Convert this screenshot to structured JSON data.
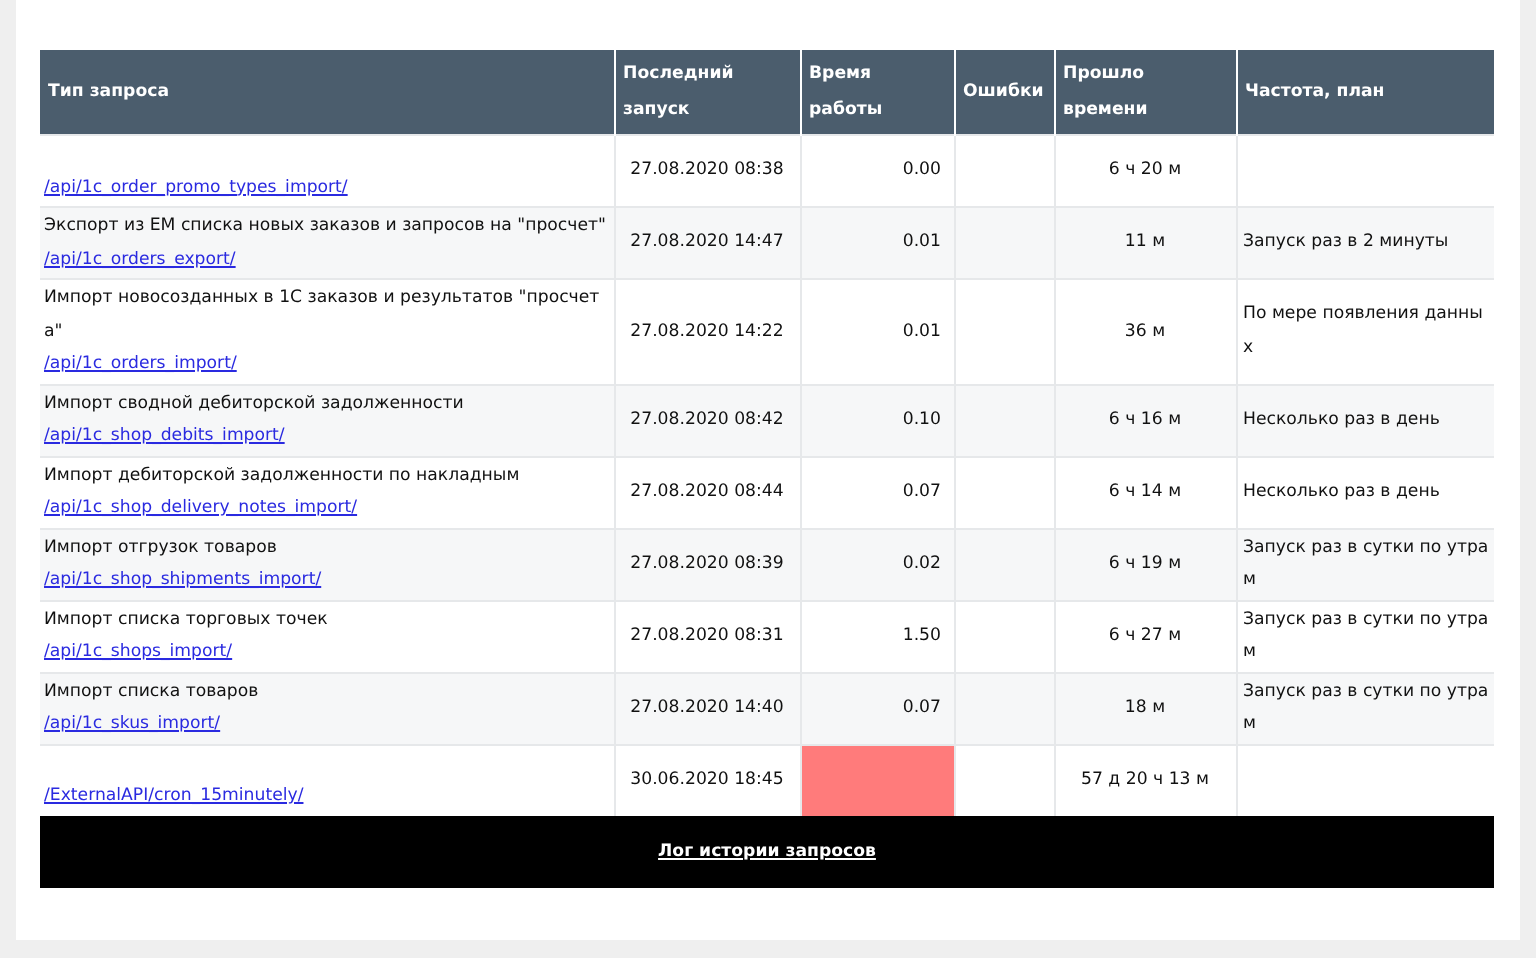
{
  "table": {
    "columns": [
      "Тип запроса",
      "Последний запуск",
      "Время работы",
      "Ошибки",
      "Прошло времени",
      "Частота, план"
    ],
    "rows": [
      {
        "endpoint": "/api/1c_order_promo_types_import/",
        "last_run": "27.08.2020 08:38",
        "runtime": "0.00",
        "elapsed": "6 ч 20 м",
        "alert": false
      },
      {
        "description": "Экспорт из ЕМ списка новых заказов и запросов на \"просчет\"",
        "endpoint": "/api/1c_orders_export/",
        "last_run": "27.08.2020 14:47",
        "runtime": "0.01",
        "elapsed": "11 м",
        "schedule": "Запуск раз в 2 минуты",
        "alert": false
      },
      {
        "description": "Импорт новосозданных в 1С заказов и результатов \"просчета\"",
        "endpoint": "/api/1c_orders_import/",
        "last_run": "27.08.2020 14:22",
        "runtime": "0.01",
        "elapsed": "36 м",
        "schedule": "По мере появления данных",
        "alert": false
      },
      {
        "description": "Импорт сводной дебиторской задолженности",
        "endpoint": "/api/1c_shop_debits_import/",
        "last_run": "27.08.2020 08:42",
        "runtime": "0.10",
        "elapsed": "6 ч 16 м",
        "schedule": "Несколько раз в день",
        "alert": false
      },
      {
        "description": "Импорт дебиторской задолженности по накладным",
        "endpoint": "/api/1c_shop_delivery_notes_import/",
        "last_run": "27.08.2020 08:44",
        "runtime": "0.07",
        "elapsed": "6 ч 14 м",
        "schedule": "Несколько раз в день",
        "alert": false
      },
      {
        "description": "Импорт отгрузок товаров",
        "endpoint": "/api/1c_shop_shipments_import/",
        "last_run": "27.08.2020 08:39",
        "runtime": "0.02",
        "elapsed": "6 ч 19 м",
        "schedule": "Запуск раз в сутки по утрам",
        "alert": false
      },
      {
        "description": "Импорт списка торговых точек",
        "endpoint": "/api/1c_shops_import/",
        "last_run": "27.08.2020 08:31",
        "runtime": "1.50",
        "elapsed": "6 ч 27 м",
        "schedule": "Запуск раз в сутки по утрам",
        "alert": false
      },
      {
        "description": "Импорт списка товаров",
        "endpoint": "/api/1c_skus_import/",
        "last_run": "27.08.2020 14:40",
        "runtime": "0.07",
        "elapsed": "18 м",
        "schedule": "Запуск раз в сутки по утрам",
        "alert": false
      },
      {
        "endpoint": "/ExternalAPI/cron_15minutely/",
        "last_run": "30.06.2020 18:45",
        "elapsed": "57 д 20 ч 13 м",
        "alert": true
      }
    ]
  },
  "footer_link": "Лог истории запросов"
}
